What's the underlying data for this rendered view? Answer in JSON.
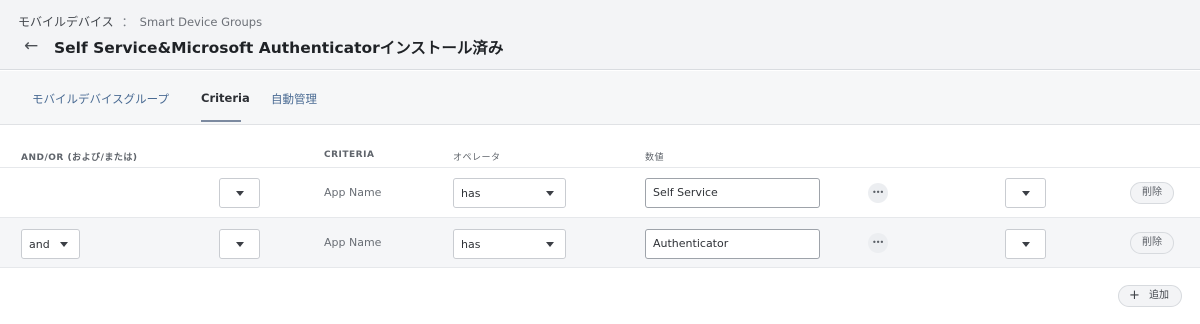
{
  "header": {
    "breadcrumb_main": "モバイルデバイス",
    "breadcrumb_sep": "：",
    "breadcrumb_sub": "Smart Device Groups",
    "title": "Self Service&Microsoft Authenticatorインストール済み",
    "back_icon": "←"
  },
  "tabs": [
    {
      "label": "モバイルデバイスグループ",
      "active": false
    },
    {
      "label": "Criteria",
      "active": true
    },
    {
      "label": "自動管理",
      "active": false
    }
  ],
  "columns": {
    "and_or": "AND/OR (および/または)",
    "criteria": "CRITERIA",
    "operator": "オペレータ",
    "value": "数値"
  },
  "rows": [
    {
      "and_or": "",
      "open_paren": "",
      "criteria": "App Name",
      "operator": "has",
      "value": "Self Service",
      "close_paren": "",
      "delete_label": "削除"
    },
    {
      "and_or": "and",
      "open_paren": "",
      "criteria": "App Name",
      "operator": "has",
      "value": "Authenticator",
      "close_paren": "",
      "delete_label": "削除"
    }
  ],
  "actions": {
    "add_label": "追加",
    "add_icon": "+",
    "more_icon": "•••"
  }
}
